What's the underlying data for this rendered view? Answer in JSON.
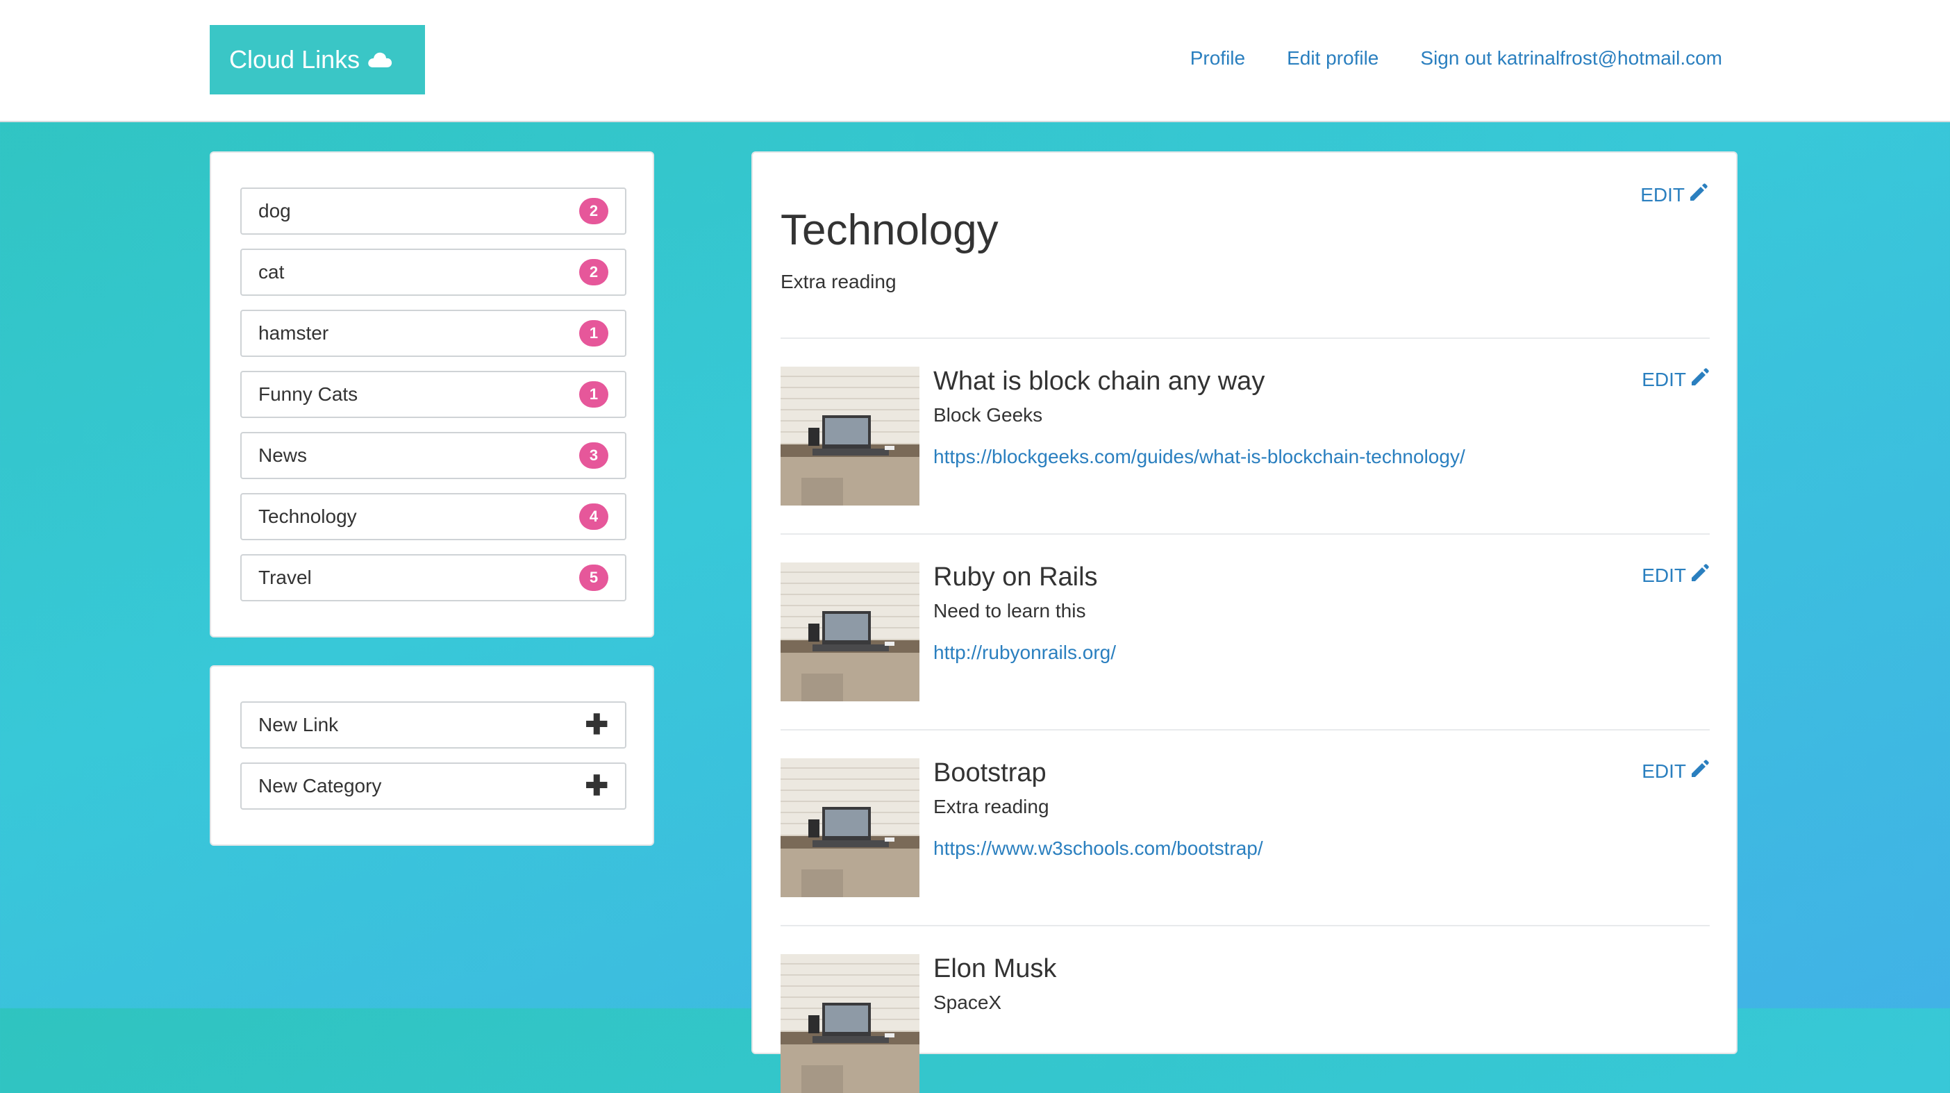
{
  "header": {
    "brand": "Cloud Links",
    "nav": [
      "Profile",
      "Edit profile",
      "Sign out katrinalfrost@hotmail.com"
    ]
  },
  "categories": [
    {
      "label": "dog",
      "count": "2"
    },
    {
      "label": "cat",
      "count": "2"
    },
    {
      "label": "hamster",
      "count": "1"
    },
    {
      "label": "Funny Cats",
      "count": "1"
    },
    {
      "label": "News",
      "count": "3"
    },
    {
      "label": "Technology",
      "count": "4"
    },
    {
      "label": "Travel",
      "count": "5"
    }
  ],
  "actions": [
    {
      "label": "New Link",
      "icon": "plus-icon"
    },
    {
      "label": "New Category",
      "icon": "plus-icon"
    }
  ],
  "main": {
    "edit_label": "EDIT",
    "title": "Technology",
    "description": "Extra reading",
    "links": [
      {
        "title": "What is block chain any way",
        "subtitle": "Block Geeks",
        "url": "https://blockgeeks.com/guides/what-is-blockchain-technology/"
      },
      {
        "title": "Ruby on Rails",
        "subtitle": "Need to learn this",
        "url": "http://rubyonrails.org/"
      },
      {
        "title": "Bootstrap",
        "subtitle": "Extra reading",
        "url": "https://www.w3schools.com/bootstrap/"
      },
      {
        "title": "Elon Musk",
        "subtitle": "SpaceX",
        "url": ""
      }
    ]
  },
  "colors": {
    "accent": "#3ac6c6",
    "link": "#2a7fbf",
    "badge": "#e6579a"
  }
}
